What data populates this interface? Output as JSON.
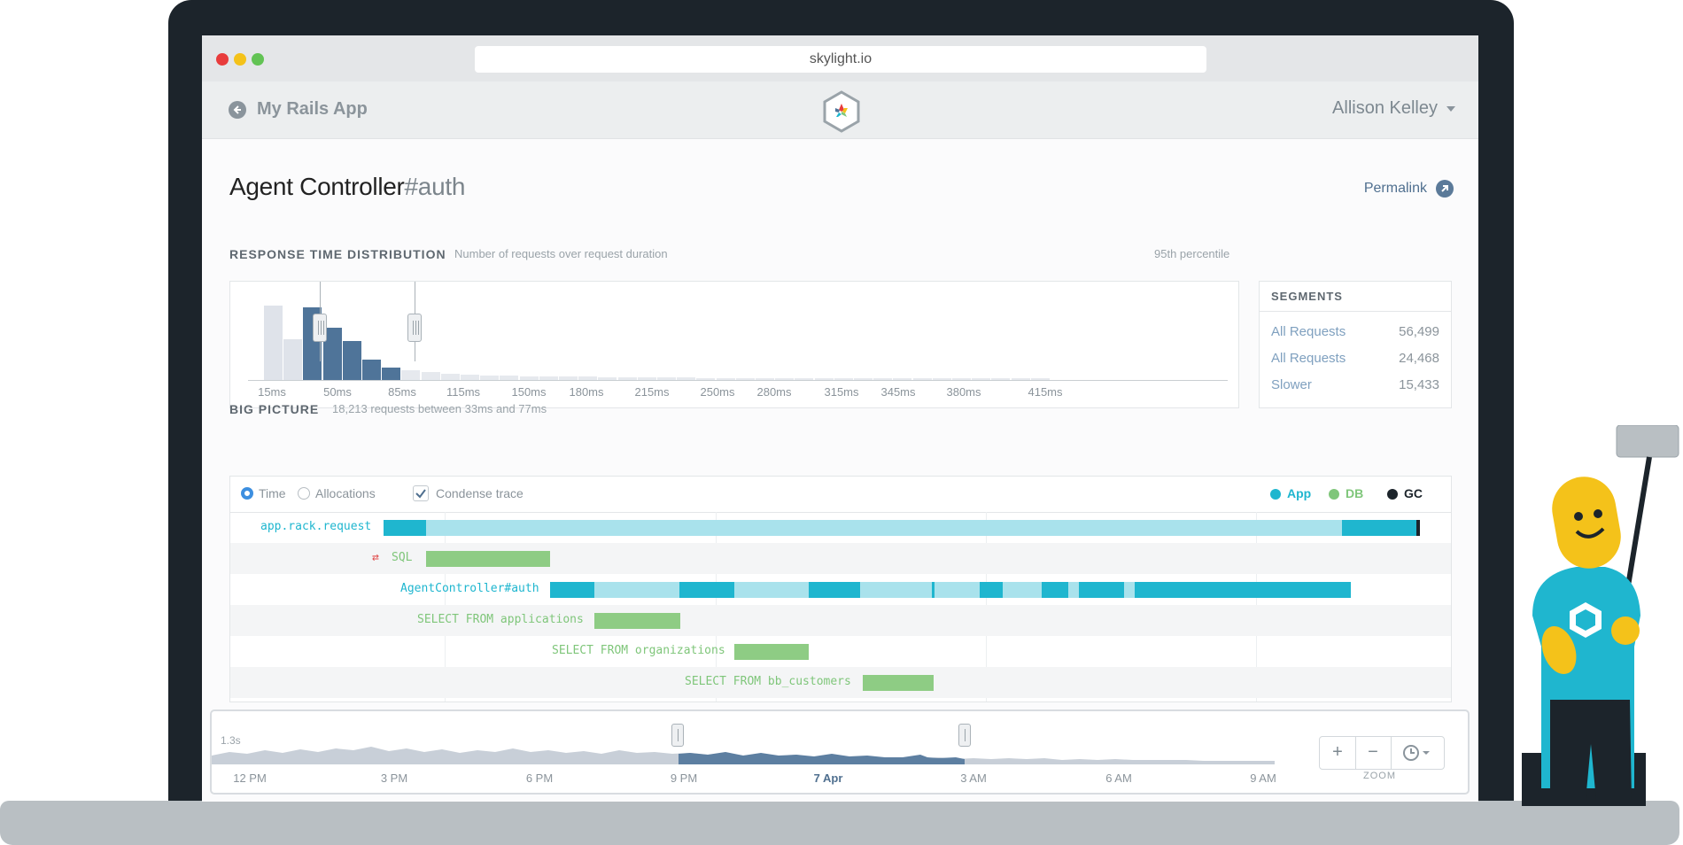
{
  "browser": {
    "url": "skylight.io",
    "traffic_lights": [
      "#e83c3c",
      "#f4c21a",
      "#62c354"
    ]
  },
  "header": {
    "app_name": "My Rails App",
    "user_name": "Allison Kelley"
  },
  "page": {
    "title_main": "Agent Controller",
    "title_action": "#auth",
    "permalink": "Permalink"
  },
  "distribution": {
    "label": "RESPONSE TIME DISTRIBUTION",
    "subtitle": "Number of requests over request duration",
    "percentile": "95th percentile",
    "ticks": [
      "15ms",
      "50ms",
      "85ms",
      "115ms",
      "150ms",
      "180ms",
      "215ms",
      "250ms",
      "280ms",
      "315ms",
      "345ms",
      "380ms",
      "415ms"
    ]
  },
  "chart_data": {
    "type": "bar",
    "values": [
      82,
      45,
      80,
      58,
      43,
      22,
      14,
      11,
      9,
      7,
      6,
      5,
      5,
      4,
      4,
      4,
      4,
      3,
      3,
      3,
      3,
      3,
      2,
      2,
      2,
      2,
      2,
      2,
      2,
      2,
      2,
      2,
      2,
      2,
      2,
      2,
      2,
      2,
      2,
      2
    ],
    "selected_range": [
      2,
      6
    ],
    "colors": {
      "selected": "#4f7499",
      "unselected": "#dfe3ea",
      "unselected_tail": "#e6e9ee"
    }
  },
  "segments": {
    "header": "SEGMENTS",
    "rows": [
      {
        "name": "All Requests",
        "value": "56,499"
      },
      {
        "name": "All Requests",
        "value": "24,468"
      },
      {
        "name": "Slower",
        "value": "15,433"
      }
    ]
  },
  "big_picture": {
    "label": "BIG PICTURE",
    "subtitle": "18,213 requests between 33ms and 77ms",
    "options": {
      "time": "Time",
      "allocations": "Allocations",
      "condense": "Condense trace"
    },
    "legend": [
      {
        "label": "App",
        "color": "#1fb6cf"
      },
      {
        "label": "DB",
        "color": "#7fc67a"
      },
      {
        "label": "GC",
        "color": "#1c242b"
      }
    ],
    "rows": [
      {
        "label": "app.rack.request",
        "kind": "app"
      },
      {
        "label": "SQL",
        "kind": "db",
        "icon": "repeat-icon"
      },
      {
        "label": "AgentController#auth",
        "kind": "app"
      },
      {
        "label": "SELECT FROM applications",
        "kind": "db"
      },
      {
        "label": "SELECT FROM organizations",
        "kind": "db"
      },
      {
        "label": "SELECT FROM bb_customers",
        "kind": "db"
      }
    ]
  },
  "timeline": {
    "max_label": "1.3s",
    "ticks": [
      "12 PM",
      "3 PM",
      "6 PM",
      "9 PM",
      "7 Apr",
      "3 AM",
      "6 AM",
      "9 AM"
    ],
    "zoom_label": "ZOOM"
  }
}
